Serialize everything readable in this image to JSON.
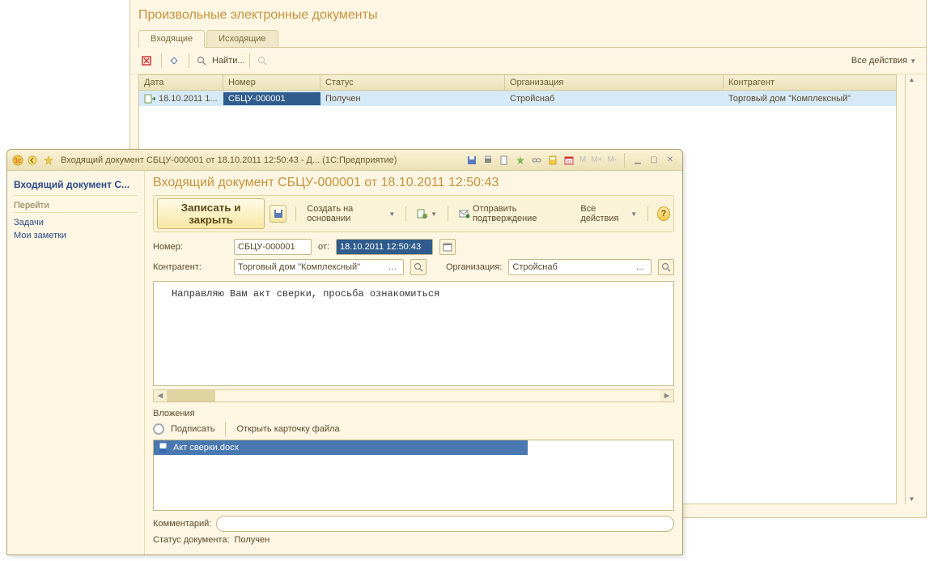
{
  "background": {
    "title": "Произвольные электронные документы",
    "tabs": {
      "incoming": "Входящие",
      "outgoing": "Исходящие"
    },
    "toolbar": {
      "search": "Найти...",
      "all_actions": "Все действия"
    },
    "columns": {
      "date": "Дата",
      "number": "Номер",
      "status": "Статус",
      "org": "Организация",
      "partner": "Контрагент"
    },
    "row": {
      "date": "18.10.2011 1...",
      "number": "СБЦУ-000001",
      "status": "Получен",
      "org": "Стройснаб",
      "partner": "Торговый дом \"Комплексный\""
    }
  },
  "window": {
    "titlebar": {
      "text": "Входящий документ СБЦУ-000001 от 18.10.2011 12:50:43 - Д...   (1С:Предприятие)",
      "m": "M",
      "mplus": "M+",
      "mminus": "M-"
    },
    "sidebar": {
      "title": "Входящий документ С...",
      "section": "Перейти",
      "links": {
        "tasks": "Задачи",
        "notes": "Мои заметки"
      }
    },
    "doc_title": "Входящий документ СБЦУ-000001 от 18.10.2011 12:50:43",
    "toolbar": {
      "save_close": "Записать и закрыть",
      "create_based": "Создать на основании",
      "send_confirm": "Отправить подтверждение",
      "all_actions": "Все действия"
    },
    "form": {
      "number_label": "Номер:",
      "number_value": "СБЦУ-000001",
      "from_label": "от:",
      "from_value": "18.10.2011 12:50:43",
      "partner_label": "Контрагент:",
      "partner_value": "Торговый дом \"Комплексный\"",
      "org_label": "Организация:",
      "org_value": "Стройснаб",
      "body_text": "Направляю Вам акт сверки, просьба ознакомиться"
    },
    "attachments": {
      "label": "Вложения",
      "sign": "Подписать",
      "open_card": "Открыть карточку файла",
      "file": "Акт сверки.docx"
    },
    "footer": {
      "comment_label": "Комментарий:",
      "status_label": "Статус документа:",
      "status_value": "Получен"
    }
  }
}
